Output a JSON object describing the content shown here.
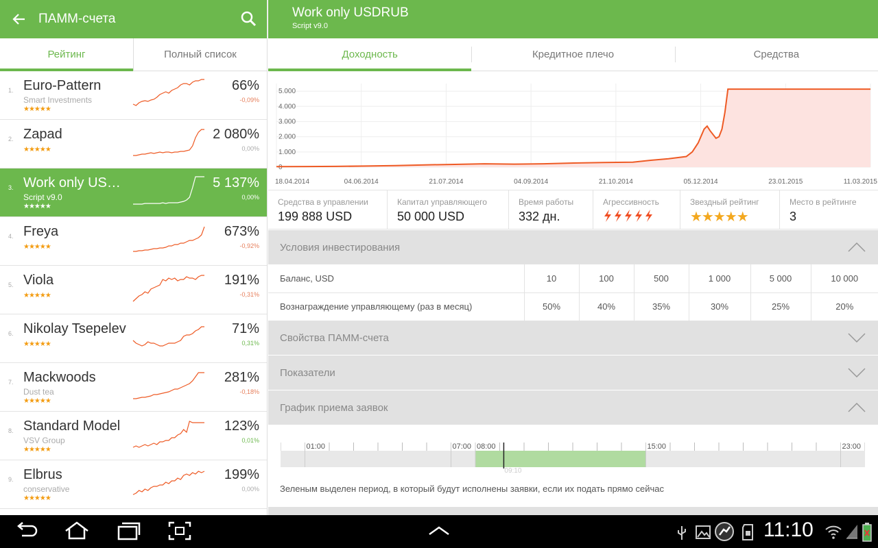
{
  "left_header": {
    "title": "ПАММ-счета",
    "back_icon": "arrow-left-icon",
    "search_icon": "search-icon"
  },
  "left_tabs": [
    "Рейтинг",
    "Полный список"
  ],
  "accounts": [
    {
      "num": "1.",
      "name": "Euro-Pattern",
      "sub": "Smart Investments",
      "stars": "★★★★★",
      "pct": "66%",
      "chg": "-0,09%",
      "chg_color": "#e67e5a",
      "spark": [
        40,
        42,
        38,
        36,
        35,
        36,
        34,
        33,
        30,
        26,
        24,
        22,
        24,
        20,
        18,
        16,
        12,
        10,
        10,
        12,
        8,
        6,
        6,
        4,
        4
      ]
    },
    {
      "num": "2.",
      "name": "Zapad",
      "sub": "",
      "stars": "★★★★★",
      "pct": "2 080%",
      "chg": "0,00%",
      "chg_color": "#aaa",
      "spark": [
        44,
        44,
        43,
        42,
        42,
        41,
        40,
        41,
        40,
        39,
        40,
        39,
        39,
        40,
        39,
        39,
        38,
        38,
        37,
        36,
        30,
        18,
        10,
        6,
        6
      ]
    },
    {
      "num": "3.",
      "name": "Work only USD…",
      "sub": "Script v9.0",
      "stars": "★★★★★",
      "pct": "5 137%",
      "chg": "0,00%",
      "chg_color": "#fff",
      "spark": [
        44,
        44,
        44,
        44,
        43,
        43,
        43,
        43,
        43,
        43,
        42,
        43,
        42,
        42,
        42,
        42,
        41,
        40,
        38,
        34,
        20,
        4,
        4,
        4,
        4
      ]
    },
    {
      "num": "4.",
      "name": "Freya",
      "sub": "",
      "stars": "★★★★★",
      "pct": "673%",
      "chg": "-0,92%",
      "chg_color": "#e67e5a",
      "spark": [
        42,
        42,
        41,
        41,
        40,
        40,
        39,
        38,
        38,
        37,
        37,
        36,
        34,
        34,
        32,
        32,
        30,
        30,
        28,
        26,
        26,
        24,
        22,
        18,
        6
      ]
    },
    {
      "num": "5.",
      "name": "Viola",
      "sub": "",
      "stars": "★★★★★",
      "pct": "191%",
      "chg": "-0,31%",
      "chg_color": "#e67e5a",
      "spark": [
        44,
        40,
        36,
        34,
        30,
        32,
        26,
        24,
        22,
        20,
        12,
        14,
        10,
        12,
        10,
        14,
        12,
        12,
        8,
        10,
        10,
        12,
        8,
        6,
        6
      ]
    },
    {
      "num": "6.",
      "name": "Nikolay Tsepelev",
      "sub": "",
      "stars": "★★★★★",
      "pct": "71%",
      "chg": "0,31%",
      "chg_color": "#6cb84d",
      "spark": [
        30,
        34,
        36,
        38,
        36,
        32,
        34,
        34,
        36,
        38,
        38,
        36,
        34,
        34,
        34,
        32,
        30,
        24,
        22,
        22,
        20,
        16,
        14,
        10,
        10
      ]
    },
    {
      "num": "7.",
      "name": "Mackwoods",
      "sub": "Dust tea",
      "stars": "★★★★★",
      "pct": "281%",
      "chg": "-0,18%",
      "chg_color": "#e67e5a",
      "spark": [
        44,
        44,
        43,
        42,
        42,
        41,
        40,
        38,
        38,
        37,
        36,
        35,
        34,
        32,
        30,
        30,
        28,
        26,
        24,
        22,
        18,
        12,
        6,
        6,
        6
      ]
    },
    {
      "num": "8.",
      "name": "Standard Model",
      "sub": "VSV Group",
      "stars": "★★★★★",
      "pct": "123%",
      "chg": "0,01%",
      "chg_color": "#6cb84d",
      "spark": [
        44,
        42,
        44,
        42,
        40,
        42,
        40,
        38,
        40,
        36,
        36,
        34,
        34,
        30,
        30,
        26,
        24,
        18,
        22,
        6,
        8,
        8,
        8,
        8,
        8
      ]
    },
    {
      "num": "9.",
      "name": "Elbrus",
      "sub": "conservative",
      "stars": "★★★★★",
      "pct": "199%",
      "chg": "0,00%",
      "chg_color": "#aaa",
      "spark": [
        42,
        40,
        36,
        38,
        34,
        36,
        32,
        30,
        30,
        28,
        28,
        24,
        26,
        22,
        22,
        18,
        20,
        14,
        12,
        14,
        10,
        12,
        8,
        10,
        8
      ]
    }
  ],
  "right_header": {
    "title": "Work only USDRUB",
    "subtitle": "Script v9.0"
  },
  "right_tabs": [
    "Доходность",
    "Кредитное плечо",
    "Средства"
  ],
  "chart_data": {
    "type": "area",
    "title": "",
    "xlabel": "",
    "ylabel": "",
    "x_ticks": [
      "18.04.2014",
      "04.06.2014",
      "21.07.2014",
      "04.09.2014",
      "21.10.2014",
      "05.12.2014",
      "23.01.2015",
      "11.03.2015"
    ],
    "y_ticks": [
      "0",
      "1.000",
      "2.000",
      "3.000",
      "4.000",
      "5.000"
    ],
    "ylim": [
      0,
      5500
    ],
    "grid": true,
    "x": [
      0,
      0.05,
      0.1,
      0.15,
      0.2,
      0.25,
      0.3,
      0.35,
      0.4,
      0.45,
      0.5,
      0.55,
      0.6,
      0.63,
      0.66,
      0.69,
      0.7,
      0.71,
      0.72,
      0.725,
      0.73,
      0.74,
      0.745,
      0.75,
      0.755,
      0.76,
      0.765,
      0.77,
      0.78,
      0.8,
      0.85,
      0.9,
      0.95,
      1.0
    ],
    "values": [
      30,
      40,
      50,
      70,
      100,
      150,
      180,
      220,
      200,
      220,
      270,
      300,
      330,
      450,
      550,
      700,
      1000,
      1600,
      2500,
      2700,
      2400,
      1900,
      2000,
      2500,
      3600,
      5137,
      5137,
      5137,
      5137,
      5137,
      5137,
      5137,
      5137,
      5137
    ]
  },
  "stats": [
    {
      "label": "Средства в управлении",
      "value": "199 888 USD"
    },
    {
      "label": "Капитал управляющего",
      "value": "50 000 USD"
    },
    {
      "label": "Время работы",
      "value": "332 дн."
    },
    {
      "label": "Агрессивность",
      "value": ""
    },
    {
      "label": "Звездный рейтинг",
      "value": "★★★★★"
    },
    {
      "label": "Место в рейтинге",
      "value": "3"
    }
  ],
  "aggressiveness_level": 5,
  "star_rating": 4.5,
  "sections": {
    "conditions": "Условия инвестирования",
    "properties": "Свойства ПАММ-счета",
    "indicators": "Показатели",
    "schedule": "График приема заявок"
  },
  "conditions_table": {
    "rows": [
      {
        "label": "Баланс, USD",
        "values": [
          "10",
          "100",
          "500",
          "1 000",
          "5 000",
          "10 000"
        ]
      },
      {
        "label": "Вознаграждение управляющему (раз в месяц)",
        "values": [
          "50%",
          "40%",
          "35%",
          "30%",
          "25%",
          "20%"
        ]
      }
    ]
  },
  "schedule": {
    "labels": [
      "01:00",
      "07:00",
      "08:00",
      "15:00",
      "23:00"
    ],
    "current_time": "09:10",
    "green_from": "08:00",
    "green_to": "15:00",
    "note": "Зеленым выделен период, в который будут исполнены заявки, если их подать прямо сейчас"
  },
  "system_bar": {
    "clock": "11:10"
  },
  "colors": {
    "accent": "#6cb84d",
    "line": "#ee5a24",
    "fill": "#fde3e0",
    "star": "#f39c12"
  }
}
